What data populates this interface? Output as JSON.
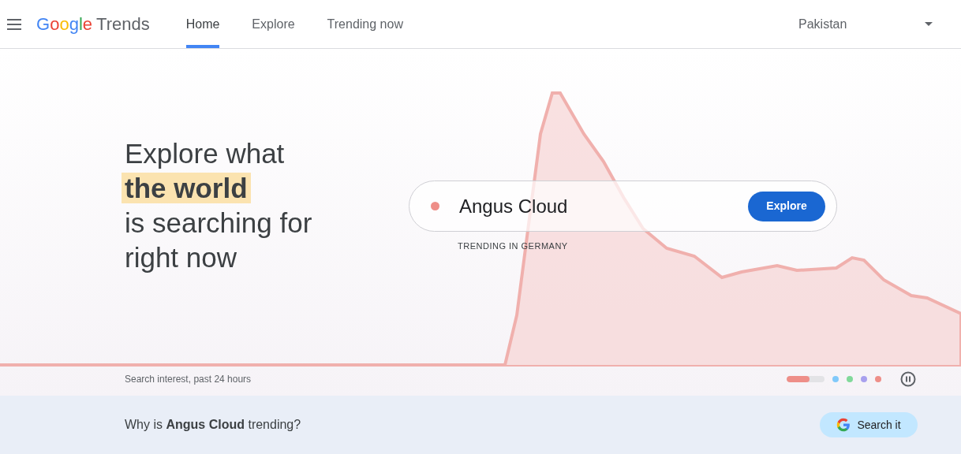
{
  "header": {
    "logo": {
      "brand": "Google",
      "product": "Trends"
    },
    "tabs": [
      {
        "label": "Home",
        "selected": true
      },
      {
        "label": "Explore",
        "selected": false
      },
      {
        "label": "Trending now",
        "selected": false
      }
    ],
    "country": "Pakistan"
  },
  "hero": {
    "headline": [
      {
        "text": "Explore what",
        "highlighted": false
      },
      {
        "text": "the world",
        "highlighted": true
      },
      {
        "text": "is searching for",
        "highlighted": false
      },
      {
        "text": "right now",
        "highlighted": false
      }
    ],
    "search": {
      "value": "Angus Cloud",
      "button": "Explore",
      "caption": "TRENDING IN GERMANY"
    },
    "chart_caption": "Search interest, past 24 hours",
    "carousel": {
      "level": 0.6,
      "dots": [
        {
          "color": "#81c9fa"
        },
        {
          "color": "#81d99a"
        },
        {
          "color": "#a8a0ee"
        },
        {
          "color": "#ee8e88"
        }
      ]
    }
  },
  "why": {
    "question": "Why is **Angus Cloud** trending?",
    "button": "Search it"
  }
}
